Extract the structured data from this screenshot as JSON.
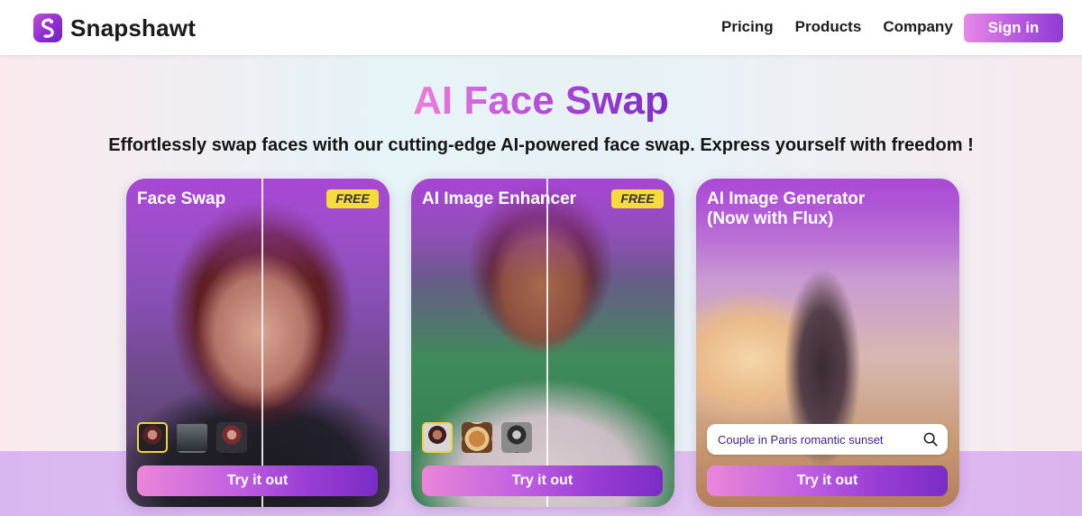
{
  "brand": {
    "name": "Snapshawt"
  },
  "nav": {
    "links": [
      "Pricing",
      "Products",
      "Company"
    ],
    "signin_label": "Sign in"
  },
  "hero": {
    "title": "AI Face Swap",
    "subtitle": "Effortlessly swap faces with our cutting-edge AI-powered face swap. Express yourself with freedom !"
  },
  "cards": [
    {
      "title": "Face Swap",
      "badge": "FREE",
      "button_label": "Try it out",
      "thumbnails": [
        "thumb-1",
        "thumb-2",
        "thumb-3"
      ],
      "active_thumbnail_index": 0
    },
    {
      "title": "AI Image Enhancer",
      "badge": "FREE",
      "button_label": "Try it out",
      "thumbnails": [
        "thumb-1",
        "thumb-2",
        "thumb-3"
      ],
      "active_thumbnail_index": 0
    },
    {
      "title": "AI Image Generator\n(Now with Flux)",
      "search_value": "Couple in Paris romantic sunset",
      "button_label": "Try it out"
    }
  ],
  "colors": {
    "accent_start": "#ea86d8",
    "accent_end": "#7b2cc6",
    "badge_yellow": "#f6db3f",
    "search_text": "#3a1f86"
  },
  "icons": {
    "logo": "snapshawt-logo-icon",
    "search": "search-icon"
  }
}
